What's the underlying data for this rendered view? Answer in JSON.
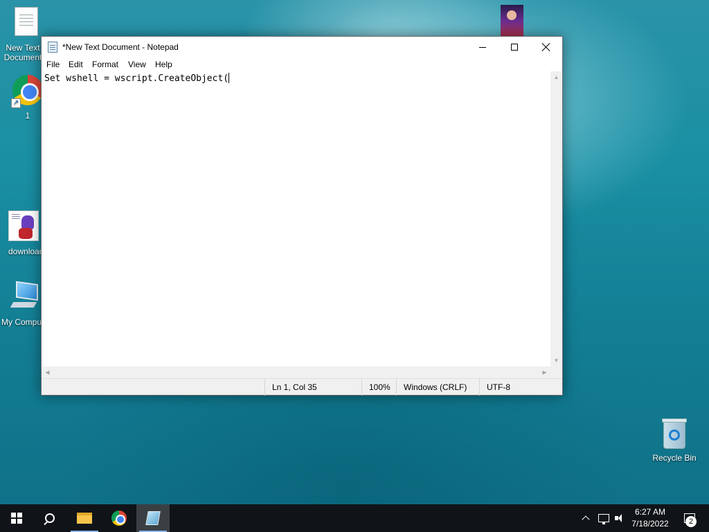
{
  "desktop": {
    "icons": [
      {
        "label": "New Text Document"
      },
      {
        "label": "1"
      },
      {
        "label": "download"
      },
      {
        "label": "My Computer"
      },
      {
        "label": "Recycle Bin"
      }
    ]
  },
  "notepad": {
    "title": "*New Text Document - Notepad",
    "menu": [
      "File",
      "Edit",
      "Format",
      "View",
      "Help"
    ],
    "content": "Set wshell = wscript.CreateObject(",
    "status": {
      "position": "Ln 1, Col 35",
      "zoom": "100%",
      "line_ending": "Windows (CRLF)",
      "encoding": "UTF-8"
    }
  },
  "taskbar": {
    "apps": [
      {
        "icon": "windows-start-icon"
      },
      {
        "icon": "search-icon"
      },
      {
        "icon": "file-explorer-icon"
      },
      {
        "icon": "chrome-icon"
      },
      {
        "icon": "notepad-icon",
        "active": true
      }
    ],
    "clock": {
      "time": "6:27 AM",
      "date": "7/18/2022"
    },
    "notification_count": "2"
  },
  "colors": {
    "taskbar_bg": "#101418",
    "desktop_bg": "#1a8fa3",
    "window_bg": "#ffffff",
    "statusbar_bg": "#f0f0f0"
  }
}
